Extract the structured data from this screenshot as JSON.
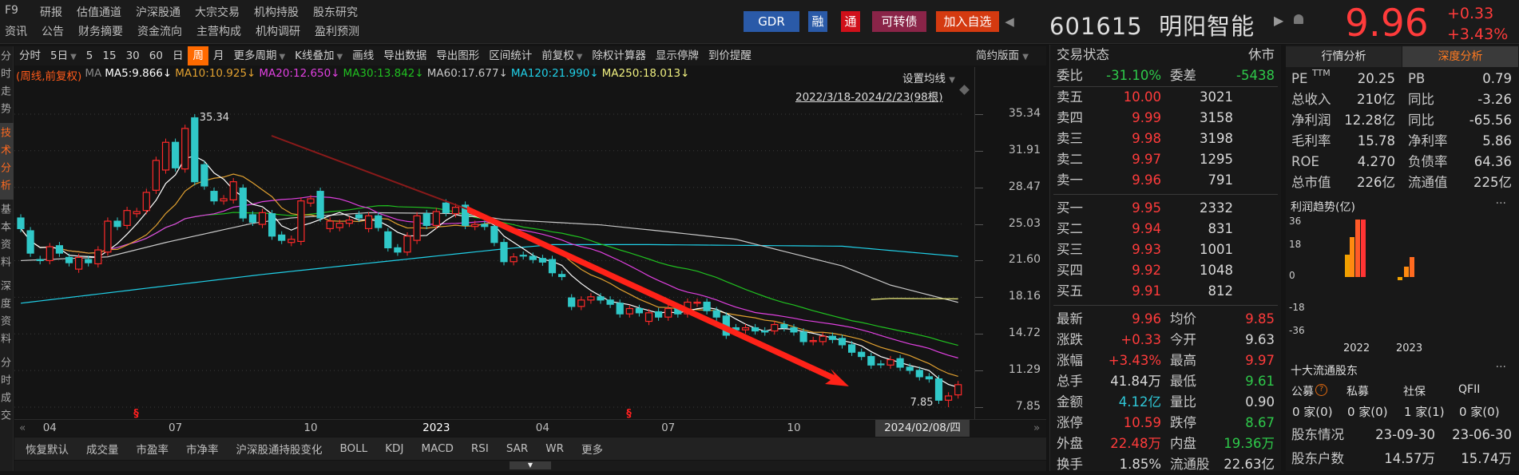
{
  "nav": {
    "row1": [
      "F9",
      "研报",
      "估值通道",
      "沪深股通",
      "大宗交易",
      "机构持股",
      "股东研究"
    ],
    "row2": [
      "资讯",
      "公告",
      "财务摘要",
      "资金流向",
      "主营构成",
      "机构调研",
      "盈利预测"
    ]
  },
  "header_buttons": {
    "gdr": "GDR",
    "rong": "融",
    "tong": "通",
    "convertible": "可转债",
    "add_watch": "加入自选",
    "collapse": "◀"
  },
  "stock": {
    "code": "601615",
    "name": "明阳智能",
    "price": "9.96",
    "change": "+0.33",
    "change_pct": "+3.43%",
    "play": "▶",
    "bell": "🔔"
  },
  "toolbar": {
    "items": [
      {
        "label": "分时",
        "dd": false
      },
      {
        "label": "5日",
        "dd": true
      },
      {
        "label": "5",
        "dd": false
      },
      {
        "label": "15",
        "dd": false
      },
      {
        "label": "30",
        "dd": false
      },
      {
        "label": "60",
        "dd": false
      },
      {
        "label": "日",
        "dd": false
      },
      {
        "label": "周",
        "dd": false,
        "active": true
      },
      {
        "label": "月",
        "dd": false
      },
      {
        "label": "更多周期",
        "dd": true
      },
      {
        "label": "K线叠加",
        "dd": true
      },
      {
        "label": "画线",
        "dd": false
      },
      {
        "label": "导出数据",
        "dd": false
      },
      {
        "label": "导出图形",
        "dd": false
      },
      {
        "label": "区间统计",
        "dd": false
      },
      {
        "label": "前复权",
        "dd": true
      },
      {
        "label": "除权计算器",
        "dd": false
      },
      {
        "label": "显示停牌",
        "dd": false
      },
      {
        "label": "到价提醒",
        "dd": false
      }
    ],
    "layout": "简约版面",
    "dd_glyph": "▼"
  },
  "side_tabs": [
    {
      "label": "分时走势"
    },
    {
      "label": "技术分析",
      "active": true
    },
    {
      "label": "基本资料"
    },
    {
      "label": "深度资料"
    },
    {
      "label": "分时成交"
    }
  ],
  "ma_legend": {
    "prefix": "(周线,前复权)",
    "ma": "MA",
    "items": [
      {
        "label": "MA5:9.866↓",
        "color": "#ffffff"
      },
      {
        "label": "MA10:10.925↓",
        "color": "#e0a030"
      },
      {
        "label": "MA20:12.650↓",
        "color": "#e040e0"
      },
      {
        "label": "MA30:13.842↓",
        "color": "#20c020"
      },
      {
        "label": "MA60:17.677↓",
        "color": "#c8c8c8"
      },
      {
        "label": "MA120:21.990↓",
        "color": "#20d0e8"
      },
      {
        "label": "MA250:18.013↓",
        "color": "#f0f080"
      }
    ]
  },
  "chart": {
    "setting": "设置均线",
    "range": "2022/3/18-2024/2/23(98根)",
    "cursor_date": "2024/02/08/四",
    "prev": "«",
    "next": "»"
  },
  "chart_data": {
    "type": "candlestick",
    "period": "weekly",
    "adjust": "前复权",
    "y_ticks": [
      "35.34",
      "31.91",
      "28.47",
      "25.03",
      "21.60",
      "18.16",
      "14.72",
      "11.29",
      "7.85"
    ],
    "ylim": [
      7.85,
      35.34
    ],
    "x_ticks": [
      {
        "label": "04",
        "index": 3
      },
      {
        "label": "07",
        "index": 16
      },
      {
        "label": "10",
        "index": 30
      },
      {
        "label": "2023",
        "index": 43
      },
      {
        "label": "04",
        "index": 54
      },
      {
        "label": "07",
        "index": 67
      },
      {
        "label": "10",
        "index": 80
      }
    ],
    "max_label": "35.34",
    "max_index": 18,
    "min_label": "7.85",
    "min_index": 96,
    "events": [
      {
        "label": "§",
        "index": 12
      },
      {
        "label": "§",
        "index": 63
      }
    ],
    "candles": [
      [
        25.6,
        24.6
      ],
      [
        24.4,
        22.3
      ],
      [
        21.7,
        21.6
      ],
      [
        21.6,
        22.9
      ],
      [
        23.0,
        22.3
      ],
      [
        21.9,
        21.4
      ],
      [
        20.8,
        21.9
      ],
      [
        21.7,
        21.4
      ],
      [
        21.3,
        22.6
      ],
      [
        22.4,
        25.3
      ],
      [
        25.3,
        24.8
      ],
      [
        24.9,
        26.3
      ],
      [
        26.0,
        26.2
      ],
      [
        26.3,
        28.0
      ],
      [
        28.2,
        31.0
      ],
      [
        30.1,
        32.7
      ],
      [
        32.7,
        30.3
      ],
      [
        30.2,
        34.0
      ],
      [
        35.0,
        29.0
      ],
      [
        30.6,
        28.6
      ],
      [
        28.1,
        27.2
      ],
      [
        27.2,
        27.4
      ],
      [
        27.3,
        29.0
      ],
      [
        28.4,
        25.6
      ],
      [
        25.9,
        25.2
      ],
      [
        25.0,
        26.1
      ],
      [
        26.0,
        23.9
      ],
      [
        24.0,
        23.5
      ],
      [
        23.3,
        23.6
      ],
      [
        23.4,
        27.2
      ],
      [
        27.0,
        27.4
      ],
      [
        28.1,
        25.6
      ],
      [
        24.6,
        25.3
      ],
      [
        24.7,
        25.1
      ],
      [
        25.1,
        25.4
      ],
      [
        25.9,
        25.6
      ],
      [
        24.6,
        25.8
      ],
      [
        25.8,
        24.7
      ],
      [
        24.3,
        22.8
      ],
      [
        22.8,
        22.4
      ],
      [
        22.4,
        23.9
      ],
      [
        23.5,
        25.8
      ],
      [
        26.0,
        24.9
      ],
      [
        24.9,
        26.2
      ],
      [
        27.0,
        26.1
      ],
      [
        26.0,
        26.6
      ],
      [
        26.8,
        24.9
      ],
      [
        24.8,
        25.0
      ],
      [
        25.0,
        24.8
      ],
      [
        24.8,
        23.3
      ],
      [
        23.3,
        21.5
      ],
      [
        21.5,
        21.95
      ],
      [
        22.1,
        22.05
      ],
      [
        22.0,
        21.7
      ],
      [
        21.8,
        21.46
      ],
      [
        21.7,
        20.46
      ],
      [
        20.3,
        20.1
      ],
      [
        18.1,
        17.3
      ],
      [
        17.3,
        17.9
      ],
      [
        17.9,
        18.2
      ],
      [
        18.2,
        17.9
      ],
      [
        17.9,
        17.5
      ],
      [
        17.6,
        16.6
      ],
      [
        16.6,
        17.1
      ],
      [
        17.1,
        16.7
      ],
      [
        15.9,
        16.7
      ],
      [
        16.8,
        16.3
      ],
      [
        16.3,
        17.1
      ],
      [
        17.2,
        16.6
      ],
      [
        16.6,
        17.7
      ],
      [
        17.6,
        17.7
      ],
      [
        17.7,
        16.9
      ],
      [
        16.9,
        16.3
      ],
      [
        16.4,
        14.6
      ],
      [
        15.3,
        15.1
      ],
      [
        15.1,
        15.3
      ],
      [
        15.3,
        15.0
      ],
      [
        15.0,
        14.9
      ],
      [
        15.0,
        15.6
      ],
      [
        15.6,
        15.3
      ],
      [
        15.3,
        14.9
      ],
      [
        14.9,
        14.0
      ],
      [
        14.0,
        14.1
      ],
      [
        14.0,
        14.5
      ],
      [
        14.5,
        14.2
      ],
      [
        14.3,
        13.7
      ],
      [
        13.7,
        13.0
      ],
      [
        13.0,
        12.6
      ],
      [
        12.6,
        11.8
      ],
      [
        11.9,
        11.85
      ],
      [
        11.8,
        12.3
      ],
      [
        12.4,
        11.6
      ],
      [
        11.6,
        11.3
      ],
      [
        11.3,
        10.7
      ],
      [
        10.7,
        10.5
      ],
      [
        10.5,
        8.5
      ],
      [
        8.5,
        8.9
      ],
      [
        9.0,
        9.96
      ]
    ],
    "long_ma": {
      "MA60": [
        [
          0,
          21.6
        ],
        [
          9,
          21.95
        ],
        [
          15,
          23.3
        ],
        [
          24,
          25.1
        ],
        [
          28,
          25.6
        ],
        [
          36,
          26.1
        ],
        [
          46,
          26.0
        ],
        [
          50,
          25.45
        ],
        [
          60,
          24.95
        ],
        [
          67,
          24.3
        ],
        [
          74,
          23.6
        ],
        [
          85,
          21.1
        ],
        [
          90,
          19.3
        ],
        [
          97,
          17.68
        ]
      ],
      "MA120": [
        [
          0,
          17.6
        ],
        [
          25,
          20.3
        ],
        [
          50,
          22.7
        ],
        [
          55,
          23.1
        ],
        [
          65,
          23.1
        ],
        [
          85,
          22.95
        ],
        [
          97,
          21.99
        ]
      ],
      "MA250": [
        [
          88,
          17.95
        ],
        [
          90,
          18.05
        ],
        [
          97,
          18.01
        ]
      ]
    }
  },
  "bottom_tabs": [
    "恢复默认",
    "成交量",
    "市盈率",
    "市净率",
    "沪深股通持股变化",
    "BOLL",
    "KDJ",
    "MACD",
    "RSI",
    "SAR",
    "WR",
    "更多"
  ],
  "orderbook": {
    "status_label": "交易状态",
    "status": "休市",
    "wb_label": "委比",
    "wb": "-31.10%",
    "wc_label": "委差",
    "wc": "-5438",
    "sell": [
      {
        "l": "卖五",
        "p": "10.00",
        "v": "3021"
      },
      {
        "l": "卖四",
        "p": "9.99",
        "v": "3158"
      },
      {
        "l": "卖三",
        "p": "9.98",
        "v": "3198"
      },
      {
        "l": "卖二",
        "p": "9.97",
        "v": "1295"
      },
      {
        "l": "卖一",
        "p": "9.96",
        "v": "791"
      }
    ],
    "buy": [
      {
        "l": "买一",
        "p": "9.95",
        "v": "2332"
      },
      {
        "l": "买二",
        "p": "9.94",
        "v": "831"
      },
      {
        "l": "买三",
        "p": "9.93",
        "v": "1001"
      },
      {
        "l": "买四",
        "p": "9.92",
        "v": "1048"
      },
      {
        "l": "买五",
        "p": "9.91",
        "v": "812"
      }
    ],
    "quote": [
      {
        "l1": "最新",
        "v1": "9.96",
        "c1": "r",
        "l2": "均价",
        "v2": "9.85",
        "c2": "r"
      },
      {
        "l1": "涨跌",
        "v1": "+0.33",
        "c1": "r",
        "l2": "今开",
        "v2": "9.63",
        "c2": "w"
      },
      {
        "l1": "涨幅",
        "v1": "+3.43%",
        "c1": "r",
        "l2": "最高",
        "v2": "9.97",
        "c2": "r"
      },
      {
        "l1": "总手",
        "v1": "41.84万",
        "c1": "w",
        "l2": "最低",
        "v2": "9.61",
        "c2": "g"
      },
      {
        "l1": "金额",
        "v1": "4.12亿",
        "c1": "c",
        "l2": "量比",
        "v2": "0.90",
        "c2": "w"
      },
      {
        "l1": "涨停",
        "v1": "10.59",
        "c1": "r",
        "l2": "跌停",
        "v2": "8.67",
        "c2": "g"
      },
      {
        "l1": "外盘",
        "v1": "22.48万",
        "c1": "r",
        "l2": "内盘",
        "v2": "19.36万",
        "c2": "g"
      },
      {
        "l1": "换手",
        "v1": "1.85%",
        "c1": "w",
        "l2": "流通股",
        "v2": "22.63亿",
        "c2": "w"
      }
    ]
  },
  "analysis": {
    "tabs": [
      "行情分析",
      "深度分析"
    ],
    "metrics": [
      {
        "l1": "PE",
        "sup": "TTM",
        "v1": "20.25",
        "l2": "PB",
        "v2": "0.79"
      },
      {
        "l1": "总收入",
        "v1": "210亿",
        "l2": "同比",
        "v2": "-3.26"
      },
      {
        "l1": "净利润",
        "v1": "12.28亿",
        "l2": "同比",
        "v2": "-65.56"
      },
      {
        "l1": "毛利率",
        "v1": "15.78",
        "l2": "净利率",
        "v2": "5.86"
      },
      {
        "l1": "ROE",
        "v1": "4.270",
        "l2": "负债率",
        "v2": "64.36"
      },
      {
        "l1": "总市值",
        "v1": "226亿",
        "l2": "流通值",
        "v2": "225亿"
      }
    ],
    "profit_title": "利润趋势(亿)",
    "more": "···",
    "profit_chart": {
      "type": "bar",
      "y_ticks": [
        "36",
        "18",
        "0",
        "-18",
        "-36"
      ],
      "years": [
        "2022",
        "2023"
      ],
      "bars": [
        {
          "year": "2022",
          "values": [
            14,
            25,
            36,
            36
          ]
        },
        {
          "year": "2023",
          "values": [
            -2,
            6.5,
            12.6
          ]
        }
      ]
    },
    "holders_title": "十大流通股东",
    "holder_types": [
      {
        "l": "公募",
        "v": "0 家(0)",
        "help": "?"
      },
      {
        "l": "私募",
        "v": "0 家(0)"
      },
      {
        "l": "社保",
        "v": "1 家(1)"
      },
      {
        "l": "QFII",
        "v": "0 家(0)"
      }
    ],
    "holders_situation": {
      "label": "股东情况",
      "d1": "23-09-30",
      "d2": "23-06-30"
    },
    "holders_count": {
      "label": "股东户数",
      "v1": "14.57万",
      "v2": "15.74万"
    }
  }
}
